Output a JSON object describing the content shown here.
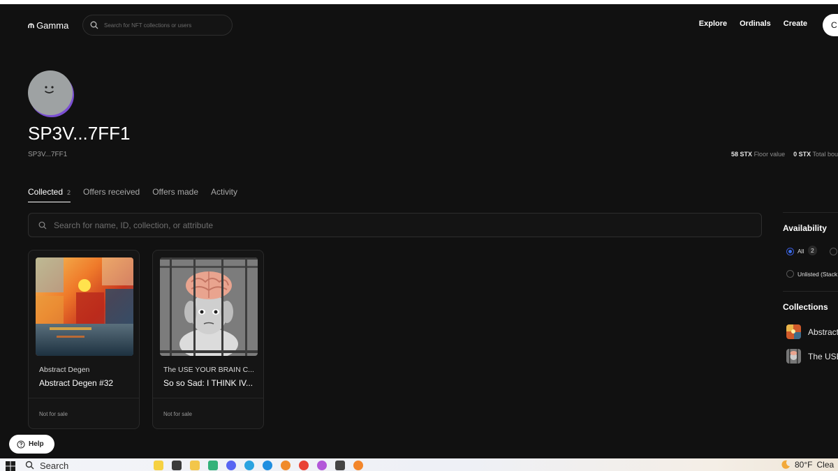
{
  "header": {
    "logo_text": "Gamma",
    "logo_mark": "⫙",
    "search_placeholder": "Search for NFT collections or users",
    "nav": [
      "Explore",
      "Ordinals",
      "Create"
    ],
    "connect_label": "C"
  },
  "profile": {
    "name": "SP3V...7FF1",
    "subname": "SP3V...7FF1",
    "stats": [
      {
        "value": "58 STX",
        "label": "Floor value"
      },
      {
        "value": "0 STX",
        "label": "Total bough"
      }
    ]
  },
  "tabs": [
    {
      "label": "Collected",
      "count": "2",
      "active": true
    },
    {
      "label": "Offers received"
    },
    {
      "label": "Offers made"
    },
    {
      "label": "Activity"
    }
  ],
  "search": {
    "placeholder": "Search for name, ID, collection, or attribute"
  },
  "cards": [
    {
      "collection": "Abstract Degen",
      "name": "Abstract Degen #32",
      "status": "Not for sale"
    },
    {
      "collection": "The USE YOUR BRAIN C...",
      "name": "So so Sad: I THINK IV...",
      "status": "Not for sale"
    }
  ],
  "sidebar": {
    "availability_title": "Availability",
    "options": [
      {
        "label": "All",
        "count": "2",
        "selected": true
      },
      {
        "label": "Unlisted (Stack"
      }
    ],
    "collections_title": "Collections",
    "collections": [
      "Abstract",
      "The USE"
    ]
  },
  "help": {
    "label": "Help"
  },
  "taskbar": {
    "search_label": "Search",
    "weather": "80°F",
    "weather_desc": "Clea"
  },
  "colors": {
    "background": "#111111",
    "accent_blue": "#3a6ee8",
    "avatar_shadow": "#7b4fd3"
  }
}
